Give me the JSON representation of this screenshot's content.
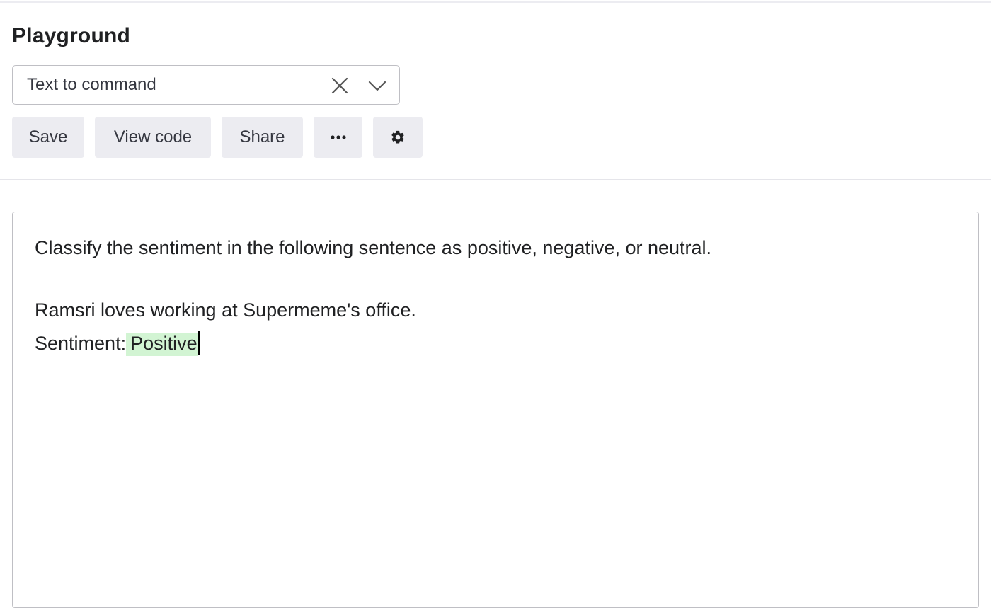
{
  "header": {
    "title": "Playground"
  },
  "preset": {
    "selected": "Text to command",
    "clear_icon": "close-icon",
    "dropdown_icon": "chevron-down-icon"
  },
  "toolbar": {
    "save_label": "Save",
    "view_code_label": "View code",
    "share_label": "Share",
    "more_icon": "more-horizontal-icon",
    "settings_icon": "gear-icon"
  },
  "editor": {
    "prompt_line_1": "Classify the sentiment in the following sentence as positive, negative, or neutral.",
    "prompt_line_2": "Ramsri loves working at Supermeme's office.",
    "prompt_prefix_3": "Sentiment:",
    "completion": "Positive",
    "completion_highlight_color": "#d2f4d3"
  }
}
